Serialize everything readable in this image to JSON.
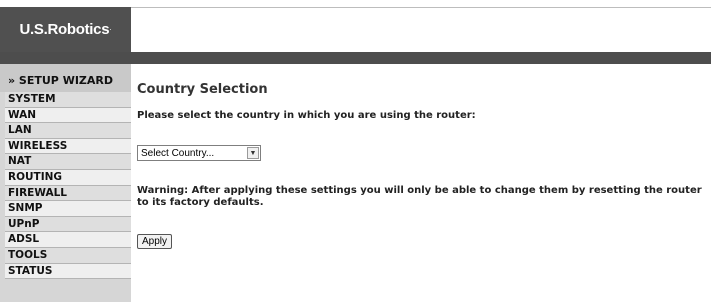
{
  "brand": {
    "name": "U.S.Robotics",
    "mark": "·"
  },
  "sidebar": {
    "wizard_label": "» SETUP WIZARD",
    "items": [
      {
        "label": "SYSTEM"
      },
      {
        "label": "WAN"
      },
      {
        "label": "LAN"
      },
      {
        "label": "WIRELESS"
      },
      {
        "label": "NAT"
      },
      {
        "label": "ROUTING"
      },
      {
        "label": "FIREWALL"
      },
      {
        "label": "SNMP"
      },
      {
        "label": "UPnP"
      },
      {
        "label": "ADSL"
      },
      {
        "label": "TOOLS"
      },
      {
        "label": "STATUS"
      }
    ]
  },
  "main": {
    "title": "Country Selection",
    "prompt": "Please select the country in which you are using the router:",
    "country_select": {
      "value": "Select Country..."
    },
    "warning": "Warning: After applying these settings you will only be able to change them by resetting the router to its factory defaults.",
    "apply_label": "Apply"
  }
}
